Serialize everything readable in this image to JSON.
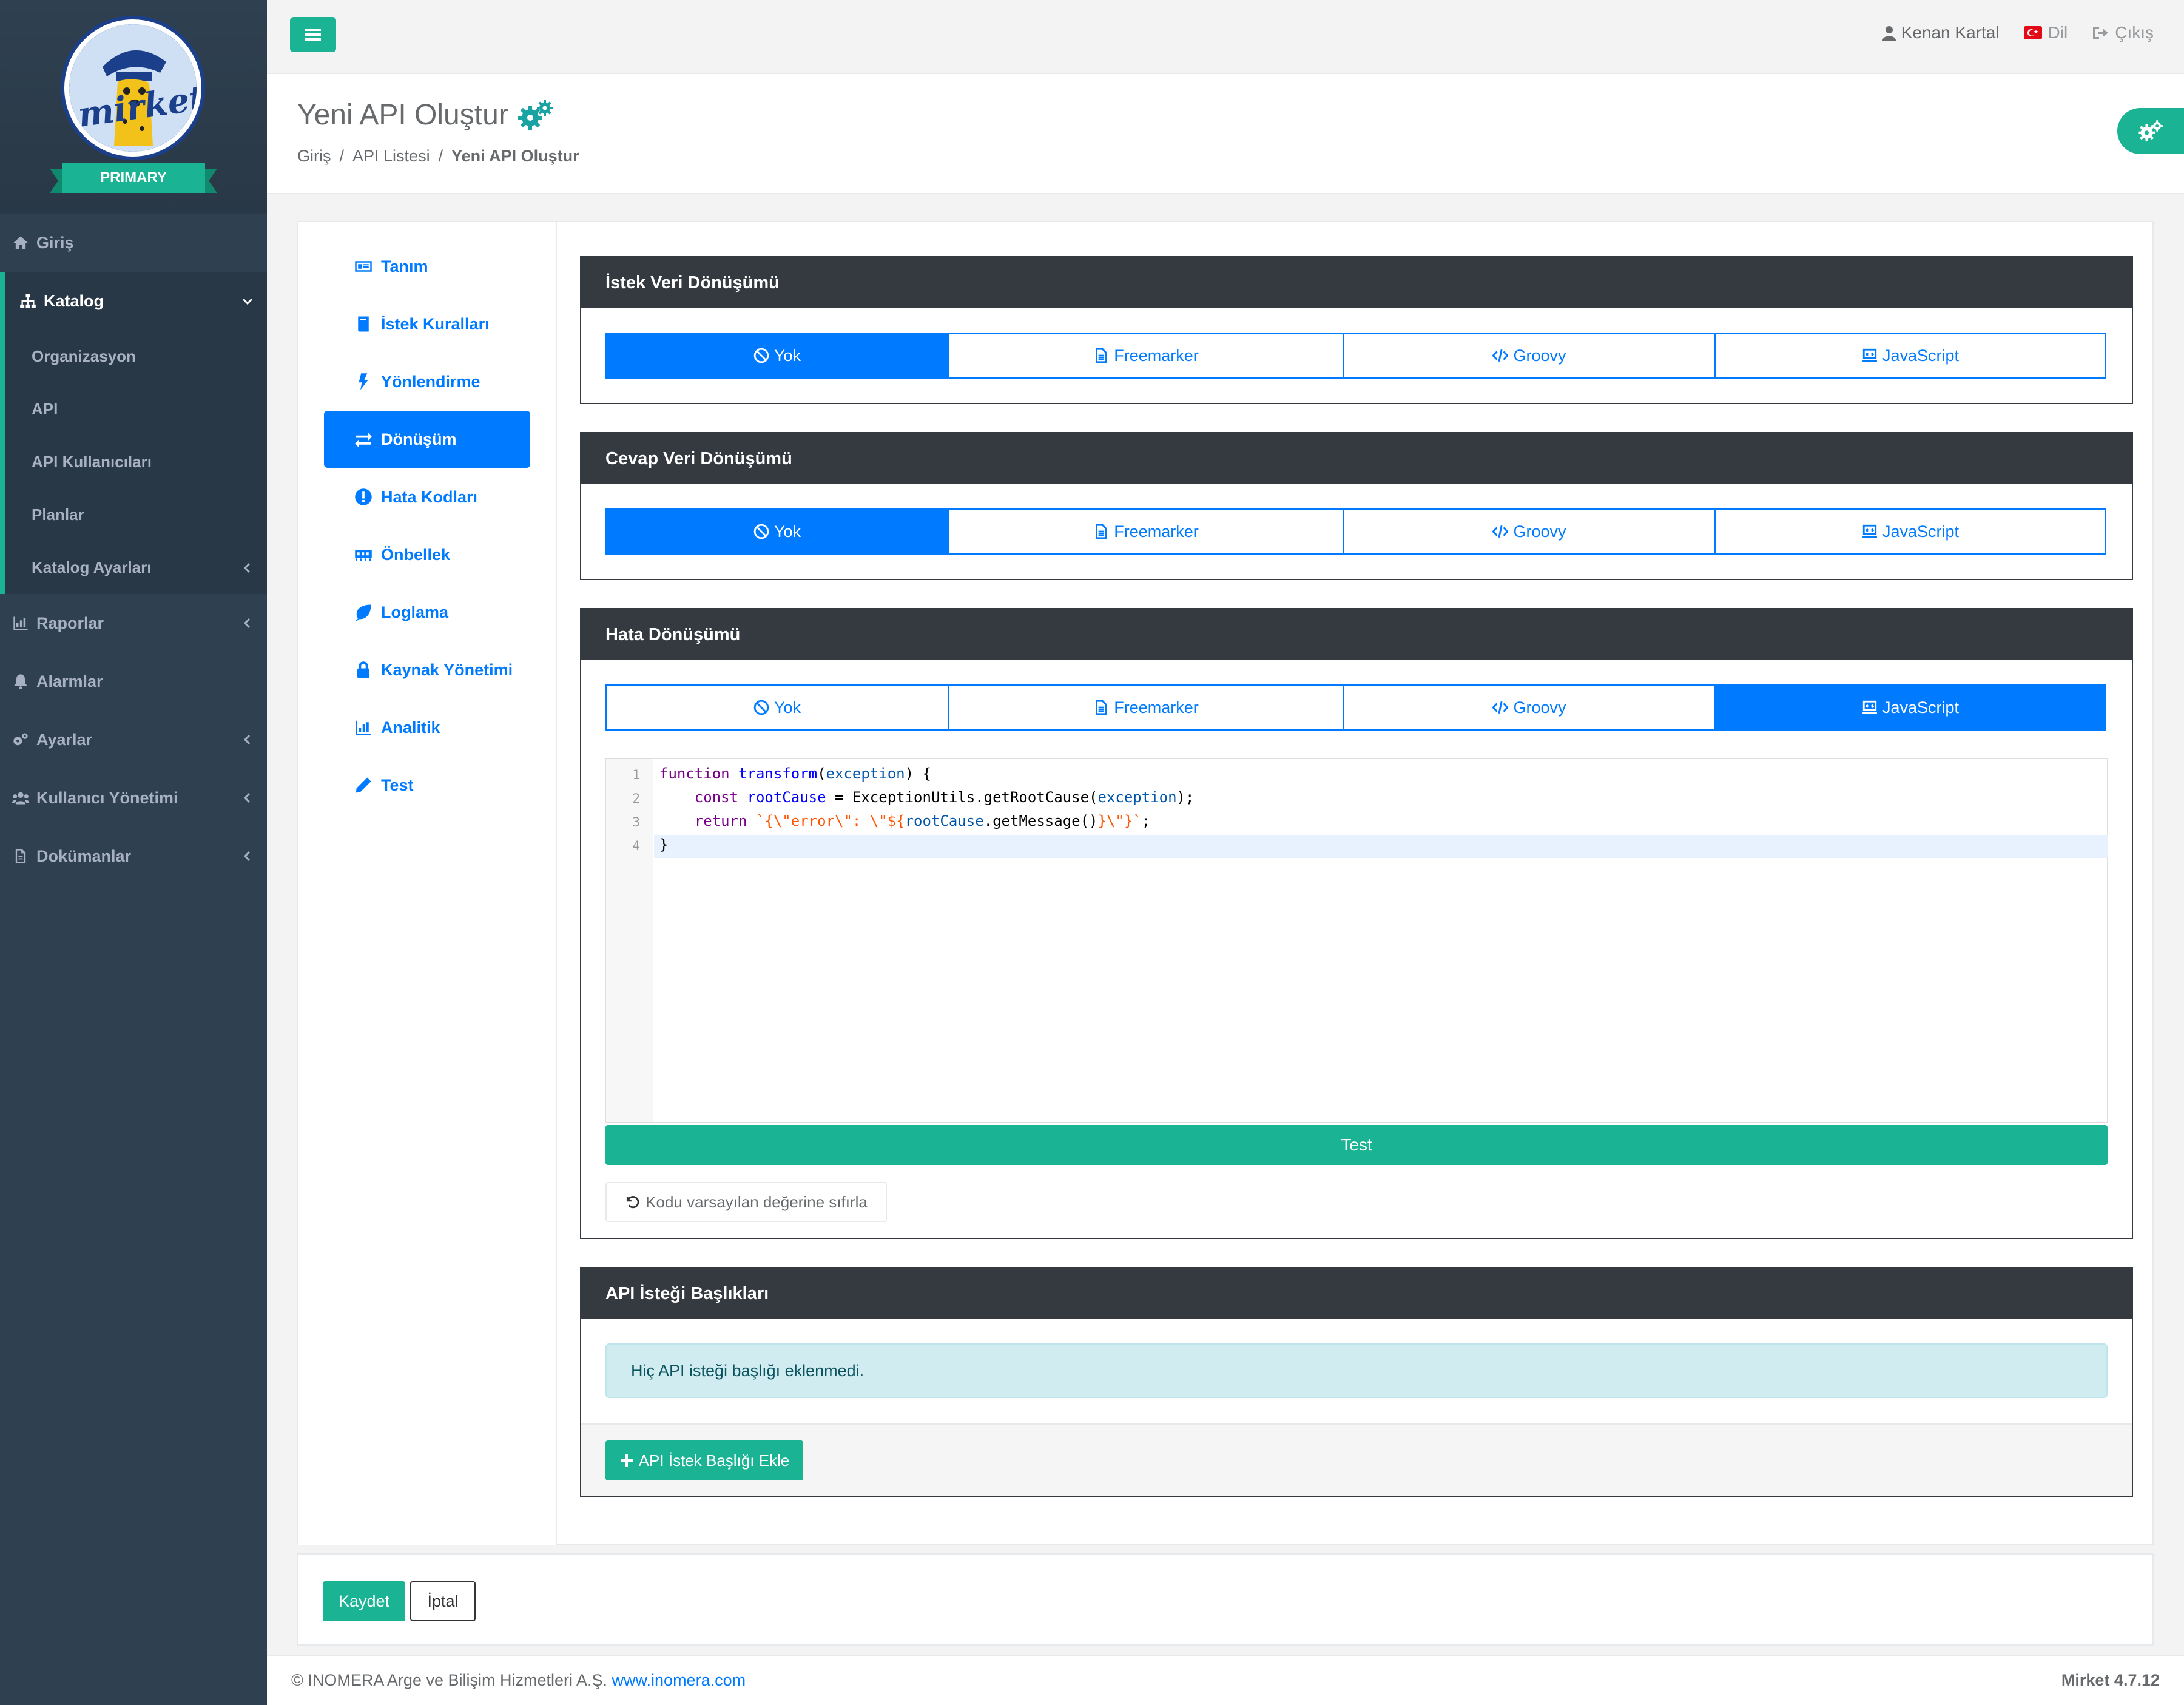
{
  "colors": {
    "sidebar": "#2f4050",
    "accent": "#1ab394",
    "primary": "#007bff",
    "panel_header": "#343a40"
  },
  "logo": {
    "ribbon": "PRIMARY",
    "wordmark": "mirket"
  },
  "sidebar": {
    "items": [
      {
        "label": "Giriş",
        "icon": "home-icon"
      },
      {
        "label": "Katalog",
        "icon": "sitemap-icon"
      },
      {
        "label": "Raporlar",
        "icon": "chart-icon"
      },
      {
        "label": "Alarmlar",
        "icon": "bell-icon"
      },
      {
        "label": "Ayarlar",
        "icon": "gears-icon"
      },
      {
        "label": "Kullanıcı Yönetimi",
        "icon": "users-icon"
      },
      {
        "label": "Dokümanlar",
        "icon": "file-icon"
      }
    ],
    "catalog_sub": [
      "Organizasyon",
      "API",
      "API Kullanıcıları",
      "Planlar",
      "Katalog Ayarları"
    ]
  },
  "topbar": {
    "user": "Kenan Kartal",
    "language": "Dil",
    "logout": "Çıkış"
  },
  "header": {
    "title": "Yeni API Oluştur",
    "breadcrumb": [
      "Giriş",
      "API Listesi",
      "Yeni API Oluştur"
    ]
  },
  "tabs": [
    {
      "label": "Tanım",
      "icon": "id-card-icon"
    },
    {
      "label": "İstek Kuralları",
      "icon": "book-icon"
    },
    {
      "label": "Yönlendirme",
      "icon": "bolt-icon"
    },
    {
      "label": "Dönüşüm",
      "icon": "exchange-icon"
    },
    {
      "label": "Hata Kodları",
      "icon": "exclamation-icon"
    },
    {
      "label": "Önbellek",
      "icon": "memory-icon"
    },
    {
      "label": "Loglama",
      "icon": "leaf-icon"
    },
    {
      "label": "Kaynak Yönetimi",
      "icon": "lock-icon"
    },
    {
      "label": "Analitik",
      "icon": "chart-icon"
    },
    {
      "label": "Test",
      "icon": "pencil-icon"
    }
  ],
  "active_tab": "Dönüşüm",
  "options": [
    "Yok",
    "Freemarker",
    "Groovy",
    "JavaScript"
  ],
  "panels": {
    "request": {
      "title": "İstek Veri Dönüşümü",
      "selected": "Yok"
    },
    "response": {
      "title": "Cevap Veri Dönüşümü",
      "selected": "Yok"
    },
    "error": {
      "title": "Hata Dönüşümü",
      "selected": "JavaScript"
    },
    "headers": {
      "title": "API İsteği Başlıkları",
      "empty_message": "Hiç API isteği başlığı eklenmedi.",
      "add_button": "API İstek Başlığı Ekle"
    }
  },
  "code": {
    "line_numbers": [
      "1",
      "2",
      "3",
      "4"
    ],
    "lines": [
      "function transform(exception) {",
      "    const rootCause = ExceptionUtils.getRootCause(exception);",
      "    return `{\\\"error\\\": \\\"${rootCause.getMessage()}\\\"}`;",
      "}"
    ]
  },
  "buttons": {
    "test": "Test",
    "reset": "Kodu varsayılan değerine sıfırla",
    "save": "Kaydet",
    "cancel": "İptal"
  },
  "footer": {
    "copyright": "© INOMERA Arge ve Bilişim Hizmetleri A.Ş.",
    "link": "www.inomera.com",
    "version": "Mirket 4.7.12"
  }
}
